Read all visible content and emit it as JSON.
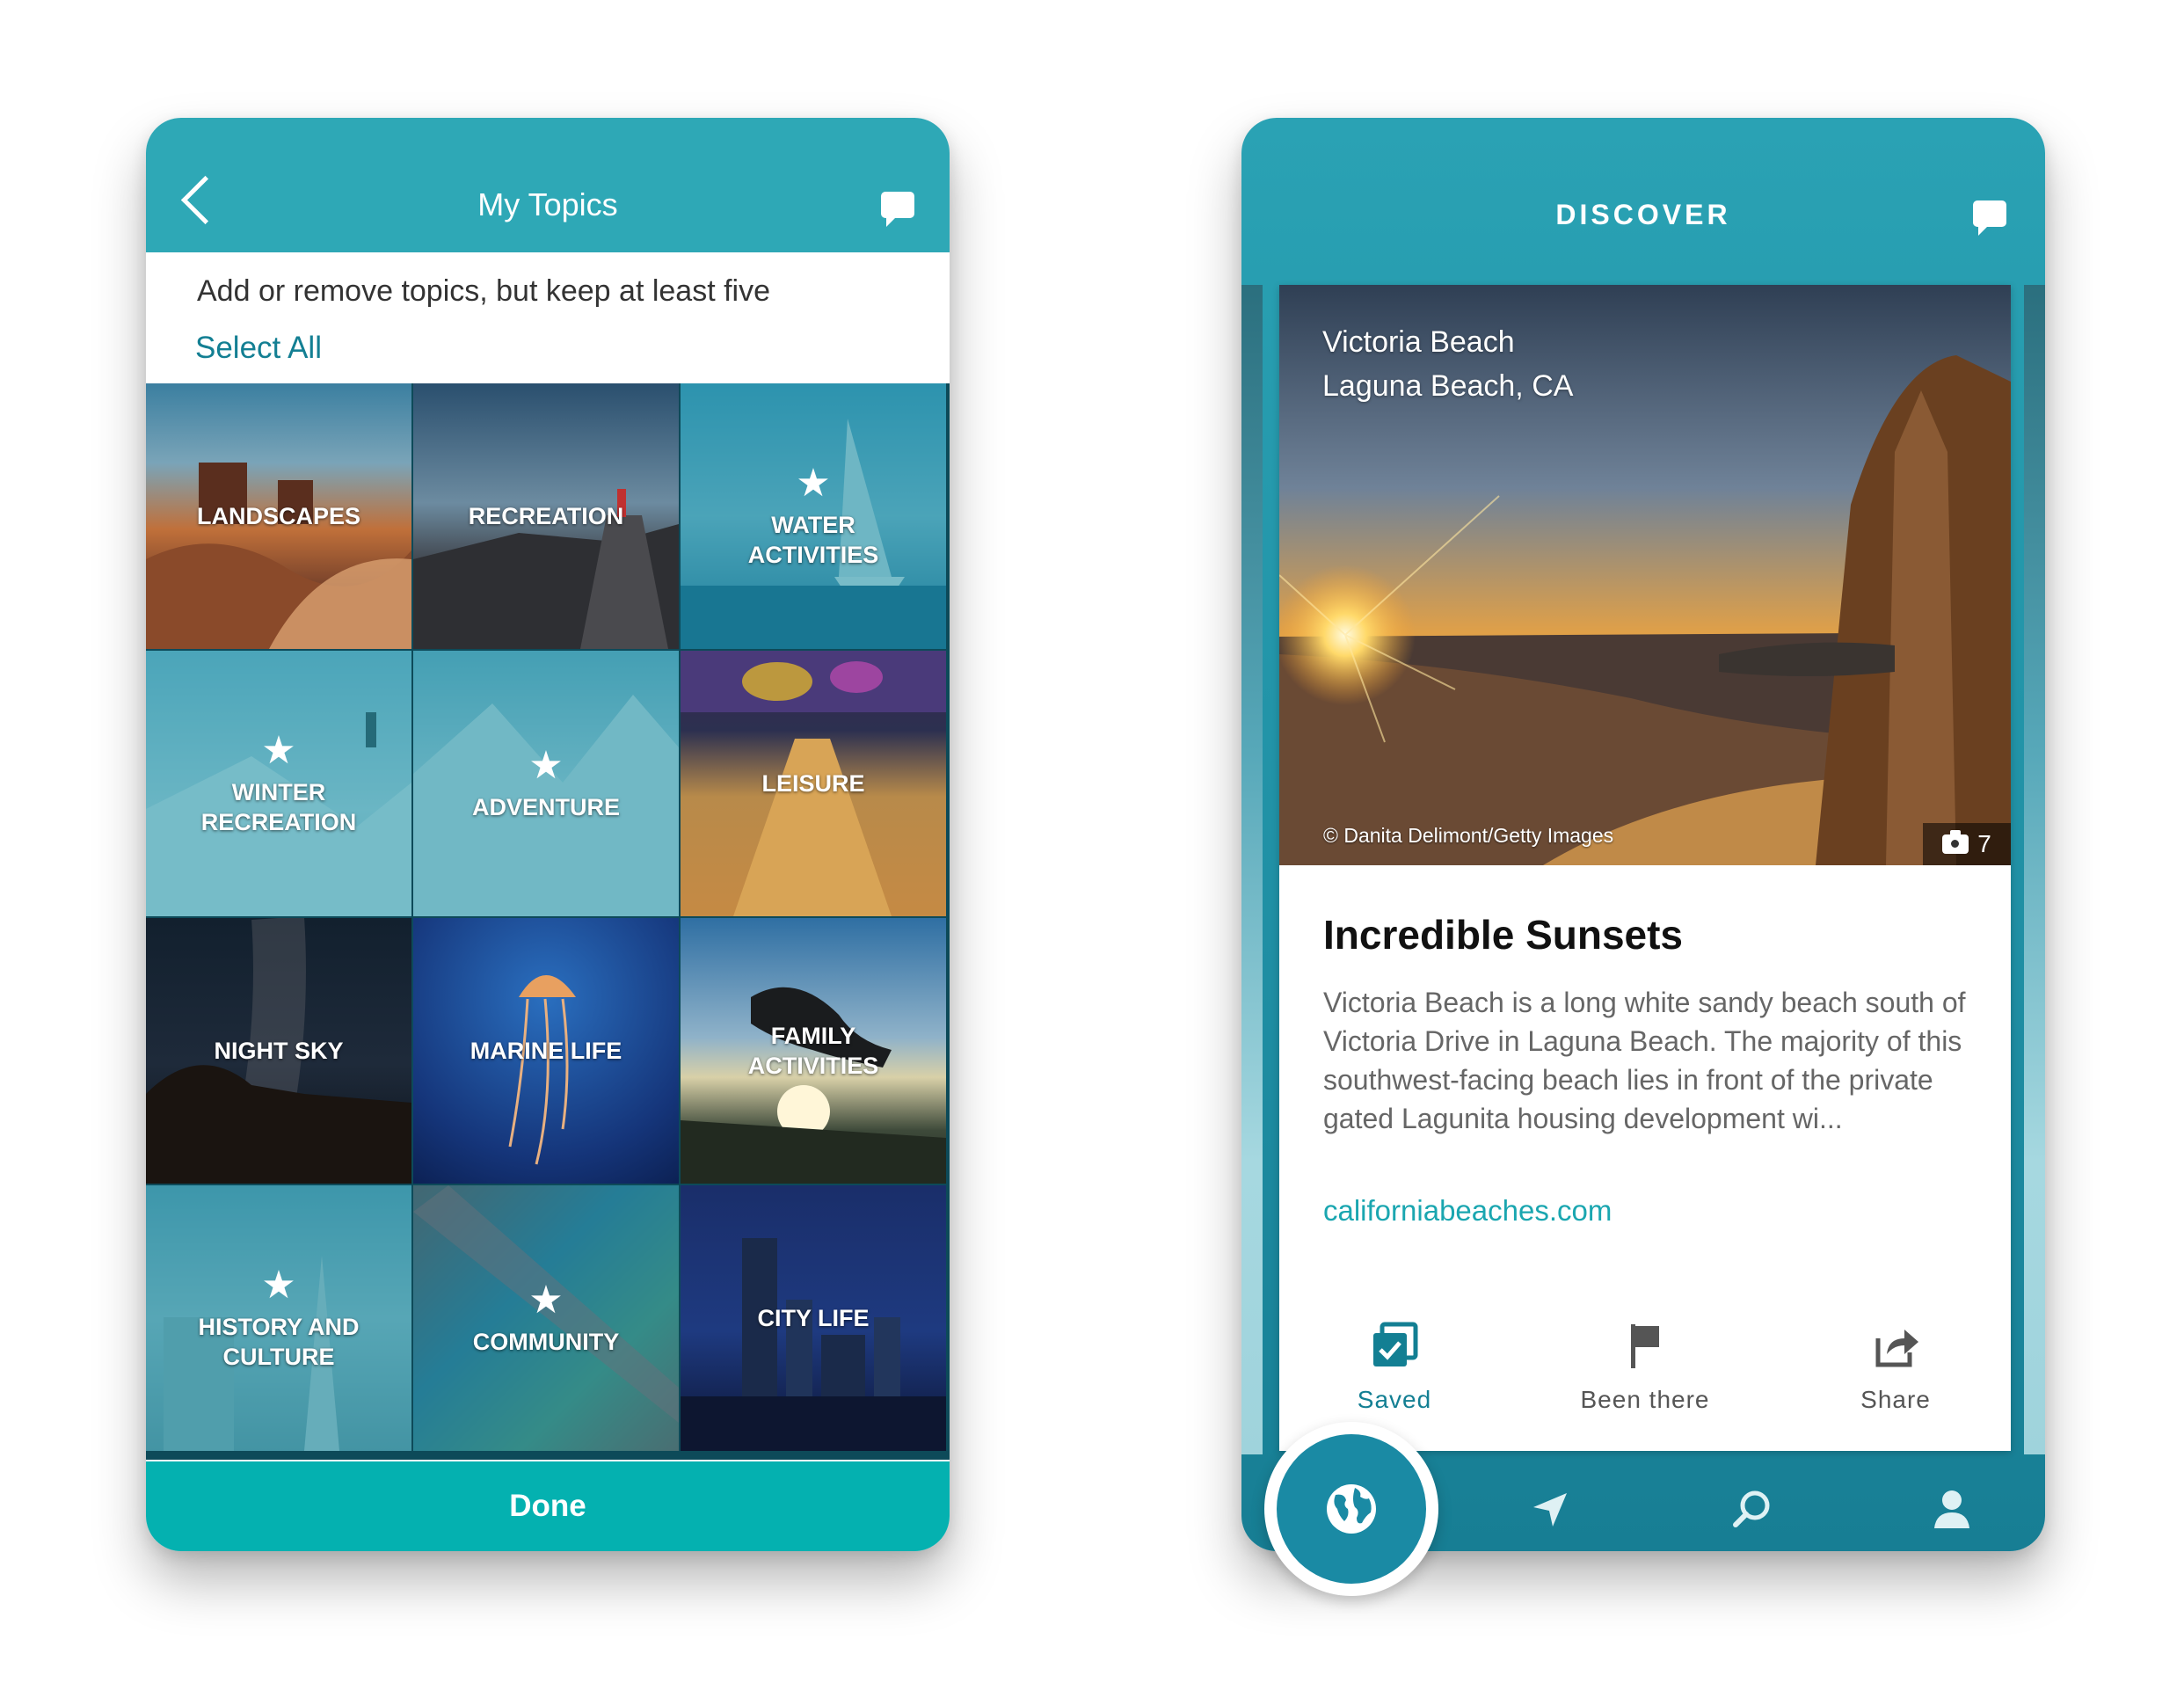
{
  "topics_screen": {
    "title": "My Topics",
    "subtitle": "Add or remove topics, but keep at least five",
    "select_all": "Select All",
    "tiles": [
      {
        "label": "LANDSCAPES",
        "selected": false
      },
      {
        "label": "RECREATION",
        "selected": false
      },
      {
        "label": "WATER\nACTIVITIES",
        "selected": true
      },
      {
        "label": "WINTER\nRECREATION",
        "selected": true
      },
      {
        "label": "ADVENTURE",
        "selected": true
      },
      {
        "label": "LEISURE",
        "selected": false
      },
      {
        "label": "NIGHT SKY",
        "selected": false
      },
      {
        "label": "MARINE LIFE",
        "selected": false
      },
      {
        "label": "FAMILY\nACTIVITIES",
        "selected": false
      },
      {
        "label": "HISTORY AND\nCULTURE",
        "selected": true
      },
      {
        "label": "COMMUNITY",
        "selected": true
      },
      {
        "label": "CITY LIFE",
        "selected": false
      }
    ],
    "star_glyph": "★",
    "done": "Done",
    "colors": {
      "header": "#2ea8b6",
      "done": "#04b1b0",
      "link": "#137f93"
    }
  },
  "discover_screen": {
    "title": "DISCOVER",
    "card": {
      "location_line1": "Victoria Beach",
      "location_line2": "Laguna Beach, CA",
      "photo_credit": "© Danita Delimont/Getty Images",
      "photo_count": "7",
      "title": "Incredible Sunsets",
      "description": "Victoria Beach is a long white sandy beach south of Victoria Drive in Laguna Beach. The majority of this southwest-facing beach lies in front of the private gated Lagunita housing development wi...",
      "link": "californiabeaches.com",
      "actions": [
        {
          "label": "Saved",
          "icon": "saved-check-icon",
          "active": true
        },
        {
          "label": "Been there",
          "icon": "flag-icon",
          "active": false
        },
        {
          "label": "Share",
          "icon": "share-icon",
          "active": false
        }
      ]
    },
    "tabbar": [
      "globe-icon",
      "navigate-arrow-icon",
      "search-icon",
      "profile-icon"
    ],
    "colors": {
      "active": "#137f93",
      "link": "#1aa6b0"
    }
  }
}
